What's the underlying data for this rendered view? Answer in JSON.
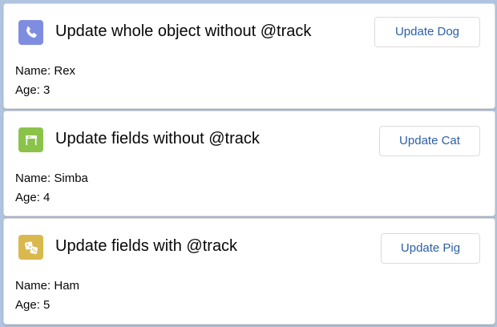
{
  "colors": {
    "page_background": "#b0c4df",
    "card_background": "#ffffff",
    "button_text": "#2c5fa6",
    "dog_icon_bg": "#7f8de1",
    "cat_icon_bg": "#8bc34a",
    "pig_icon_bg": "#d9b84e"
  },
  "cards": [
    {
      "title": "Update whole object without @track",
      "icon": "phone-icon",
      "button_label": "Update Dog",
      "name_label": "Name:",
      "name_value": "Rex",
      "age_label": "Age:",
      "age_value": "3"
    },
    {
      "title": "Update fields without @track",
      "icon": "stove-icon",
      "button_label": "Update Cat",
      "name_label": "Name:",
      "name_value": "Simba",
      "age_label": "Age:",
      "age_value": "4"
    },
    {
      "title": "Update fields with @track",
      "icon": "dice-icon",
      "button_label": "Update Pig",
      "name_label": "Name:",
      "name_value": "Ham",
      "age_label": "Age:",
      "age_value": "5"
    }
  ]
}
